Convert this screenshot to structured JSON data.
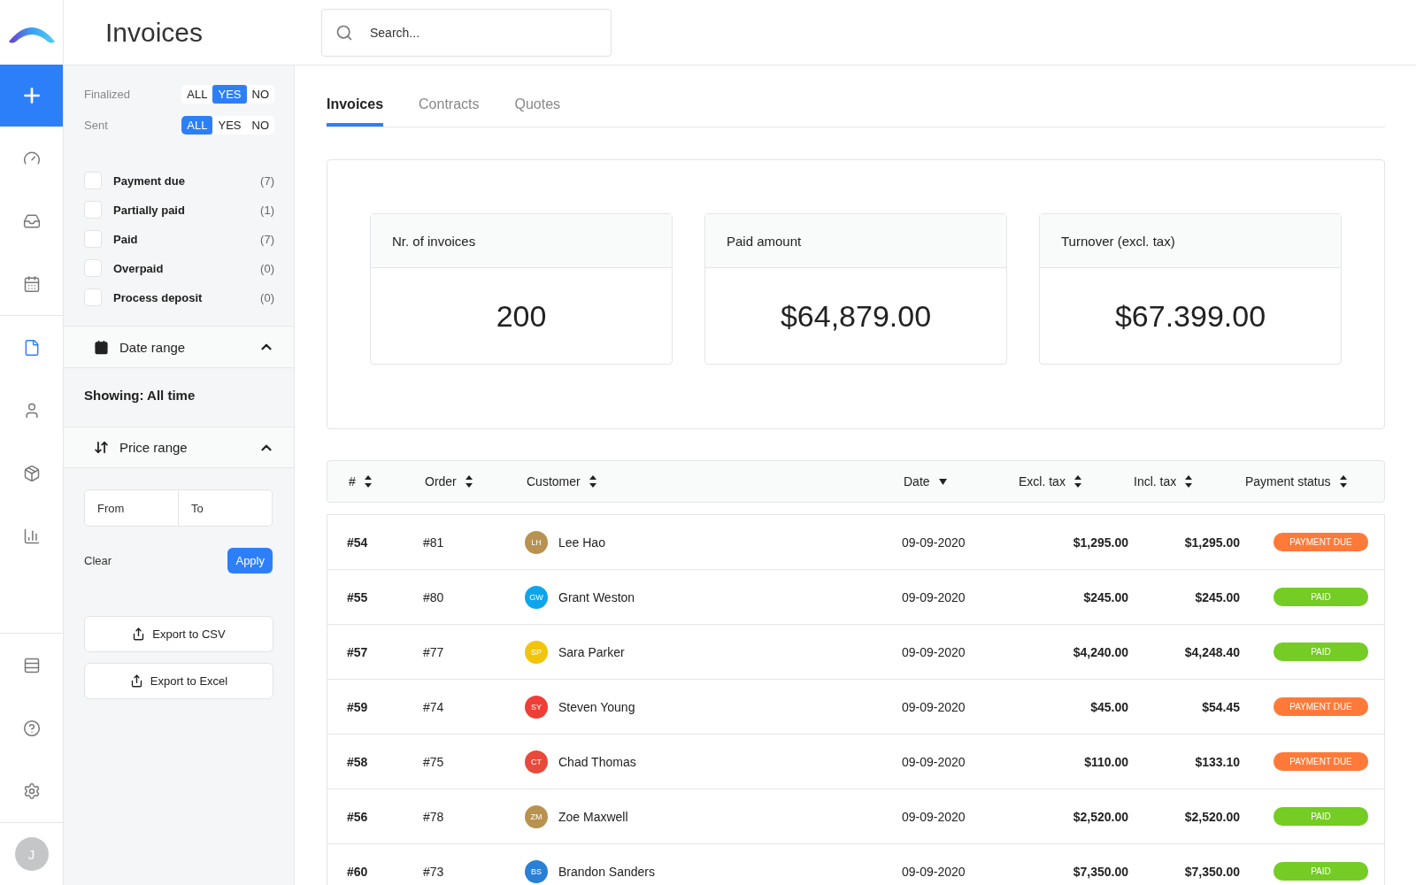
{
  "header": {
    "title": "Invoices",
    "search": {
      "placeholder": "Search..."
    }
  },
  "nav": {
    "items": [
      {
        "selected": false
      },
      {
        "selected": false
      },
      {
        "selected": false
      },
      {
        "selected": true
      },
      {
        "selected": false
      },
      {
        "selected": false
      },
      {
        "selected": false
      }
    ],
    "user_initial": "J"
  },
  "filters": {
    "toggles": [
      {
        "label": "Finalized",
        "options": [
          {
            "label": "ALL",
            "selected": false
          },
          {
            "label": "YES",
            "selected": true
          },
          {
            "label": "NO",
            "selected": false
          }
        ]
      },
      {
        "label": "Sent",
        "options": [
          {
            "label": "ALL",
            "selected": true
          },
          {
            "label": "YES",
            "selected": false
          },
          {
            "label": "NO",
            "selected": false
          }
        ]
      }
    ],
    "statuses": [
      {
        "label": "Payment due",
        "count": "(7)",
        "checked": false
      },
      {
        "label": "Partially paid",
        "count": "(1)",
        "checked": false
      },
      {
        "label": "Paid",
        "count": "(7)",
        "checked": false
      },
      {
        "label": "Overpaid",
        "count": "(0)",
        "checked": false
      },
      {
        "label": "Process deposit",
        "count": "(0)",
        "checked": false
      }
    ],
    "date_range": {
      "label": "Date range",
      "expanded": true,
      "showing": "Showing: All time"
    },
    "price_range": {
      "label": "Price range",
      "expanded": true,
      "from_placeholder": "From",
      "to_placeholder": "To",
      "clear": "Clear",
      "apply": "Apply"
    },
    "exports": [
      "Export to CSV",
      "Export to Excel"
    ]
  },
  "tabs": [
    {
      "label": "Invoices",
      "selected": true
    },
    {
      "label": "Contracts",
      "selected": false
    },
    {
      "label": "Quotes",
      "selected": false
    }
  ],
  "stats": [
    {
      "label": "Nr. of invoices",
      "value": "200"
    },
    {
      "label": "Paid amount",
      "value": "$64,879.00"
    },
    {
      "label": "Turnover (excl. tax)",
      "value": "$67.399.00"
    }
  ],
  "table": {
    "columns": [
      {
        "label": "#",
        "sorted": false
      },
      {
        "label": "Order",
        "sorted": false
      },
      {
        "label": "Customer",
        "sorted": false
      },
      {
        "label": "Date",
        "sorted": true
      },
      {
        "label": "Excl. tax",
        "sorted": false
      },
      {
        "label": "Incl. tax",
        "sorted": false
      },
      {
        "label": "Payment status",
        "sorted": false
      }
    ],
    "rows": [
      {
        "id": "#54",
        "order": "#81",
        "initials": "LH",
        "color": "#b8924f",
        "customer": "Lee Hao",
        "date": "09-09-2020",
        "excl": "$1,295.00",
        "incl": "$1,295.00",
        "status": {
          "label": "PAYMENT DUE",
          "color": "#ff7a38"
        }
      },
      {
        "id": "#55",
        "order": "#80",
        "initials": "GW",
        "color": "#0ea5ec",
        "customer": "Grant Weston",
        "date": "09-09-2020",
        "excl": "$245.00",
        "incl": "$245.00",
        "status": {
          "label": "PAID",
          "color": "#74cc24"
        }
      },
      {
        "id": "#57",
        "order": "#77",
        "initials": "SP",
        "color": "#f2c40c",
        "customer": "Sara Parker",
        "date": "09-09-2020",
        "excl": "$4,240.00",
        "incl": "$4,248.40",
        "status": {
          "label": "PAID",
          "color": "#74cc24"
        }
      },
      {
        "id": "#59",
        "order": "#74",
        "initials": "SY",
        "color": "#ef3e36",
        "customer": "Steven Young",
        "date": "09-09-2020",
        "excl": "$45.00",
        "incl": "$54.45",
        "status": {
          "label": "PAYMENT DUE",
          "color": "#ff7a38"
        }
      },
      {
        "id": "#58",
        "order": "#75",
        "initials": "CT",
        "color": "#e8493b",
        "customer": "Chad Thomas",
        "date": "09-09-2020",
        "excl": "$110.00",
        "incl": "$133.10",
        "status": {
          "label": "PAYMENT DUE",
          "color": "#ff7a38"
        }
      },
      {
        "id": "#56",
        "order": "#78",
        "initials": "ZM",
        "color": "#b8924f",
        "customer": "Zoe Maxwell",
        "date": "09-09-2020",
        "excl": "$2,520.00",
        "incl": "$2,520.00",
        "status": {
          "label": "PAID",
          "color": "#74cc24"
        }
      },
      {
        "id": "#60",
        "order": "#73",
        "initials": "BS",
        "color": "#2a7fd6",
        "customer": "Brandon Sanders",
        "date": "09-09-2020",
        "excl": "$7,350.00",
        "incl": "$7,350.00",
        "status": {
          "label": "PAID",
          "color": "#74cc24"
        }
      }
    ]
  }
}
